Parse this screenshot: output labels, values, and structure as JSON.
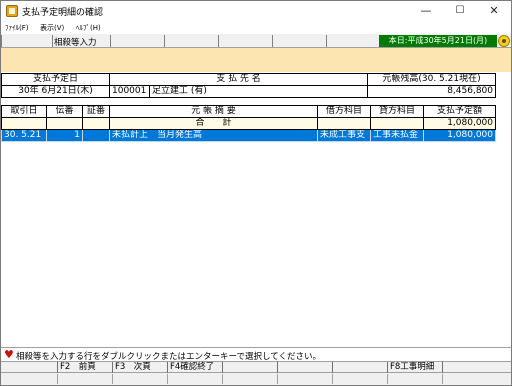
{
  "window": {
    "title": "支払予定明細の確認",
    "minimize": "—",
    "maximize": "☐",
    "close": "✕"
  },
  "menu": [
    "ﾌｧｲﾙ(F)",
    "表示(V)",
    "ﾍﾙﾌﾟ(H)"
  ],
  "toolbar": {
    "mode_label": "相殺等入力",
    "date_badge": "本日:平成30年5月21日(月)"
  },
  "info_table": {
    "headers": [
      "支払予定日",
      "支 払 先 名",
      "元帳残高(30. 5.21現在)"
    ],
    "date": "30年 6月21日(木)",
    "vendor_code": "100001",
    "vendor_name": "足立建工 (有)",
    "balance": "8,456,800"
  },
  "ledger": {
    "headers": [
      "取引日",
      "伝番",
      "証番",
      "元 帳 摘 要",
      "借方科目",
      "貸方科目",
      "支払予定額"
    ],
    "total_label": "合　　計",
    "total_amount": "1,080,000",
    "rows": [
      {
        "date": "30. 5.21",
        "slip": "1",
        "voucher": "",
        "summary": "未払計上　当月発生高",
        "debit": "未成工事支",
        "credit": "工事未払金",
        "amount": "1,080,000"
      }
    ]
  },
  "status": {
    "message": "相殺等を入力する行をダブルクリックまたはエンターキーで選択してください。"
  },
  "function_keys": [
    "F2　前頁",
    "F3　次頁",
    "F4確認終了",
    "",
    "",
    "",
    "F8工事明細"
  ]
}
